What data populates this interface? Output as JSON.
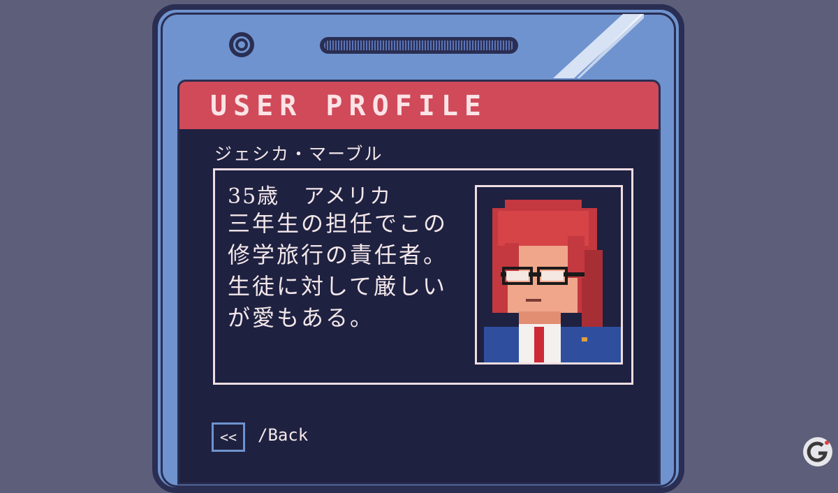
{
  "screen": {
    "header_title": "USER PROFILE",
    "profile_name": "ジェシカ・マーブル"
  },
  "card": {
    "age": "35歳",
    "country": "アメリカ",
    "description_lines": [
      "三年生の担任でこの",
      "修学旅行の責任者。",
      "生徒に対して厳しい",
      "が愛もある。"
    ]
  },
  "footer": {
    "back_button_glyph": "<<",
    "back_label": "/Back"
  },
  "icons": {
    "camera": "camera-icon",
    "back": "rewind-icon",
    "watermark": "gamer-logo-icon"
  },
  "colors": {
    "background": "#5d5e7a",
    "phone_body": "#6f93cf",
    "screen": "#1e2140",
    "header": "#d04a5a",
    "text": "#f3e7ea"
  }
}
